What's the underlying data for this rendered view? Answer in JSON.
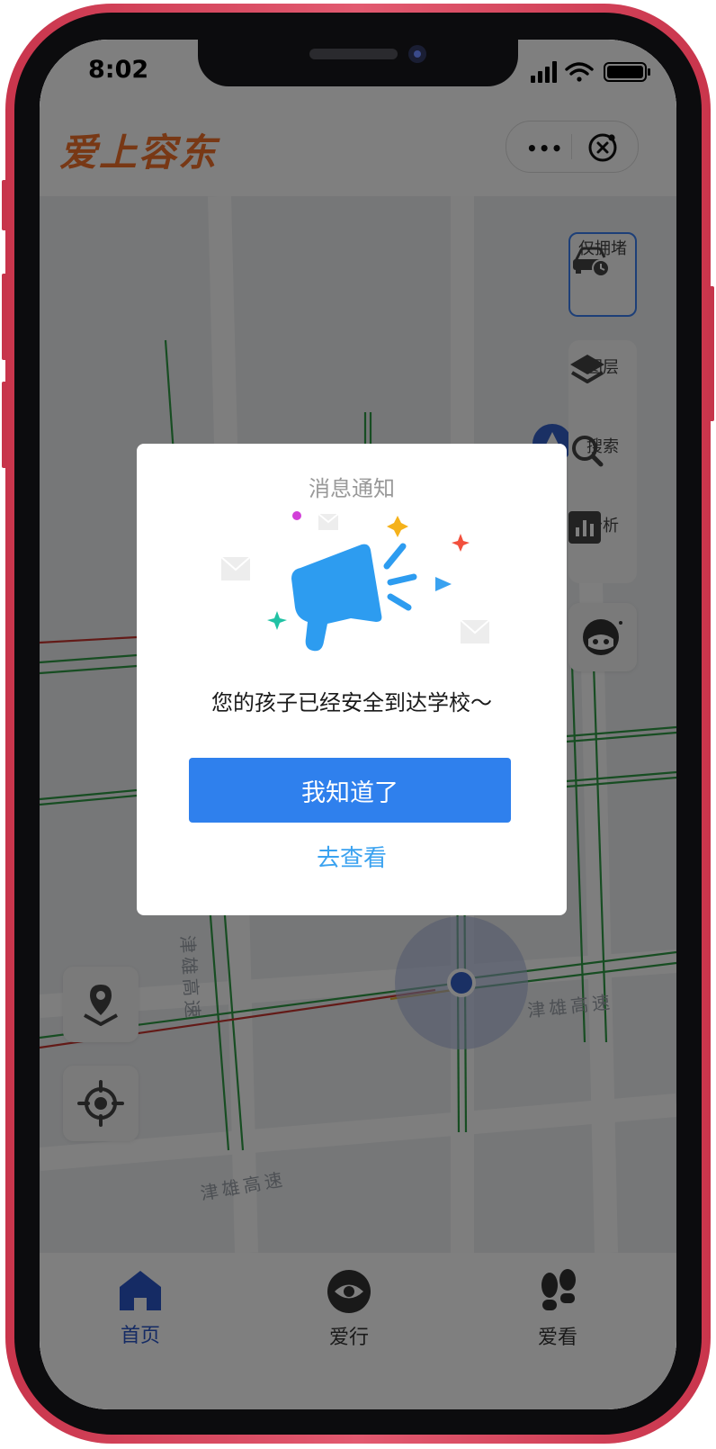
{
  "status_bar": {
    "time": "8:02"
  },
  "header": {
    "app_title": "爱上容东"
  },
  "map": {
    "congestion_filter_label": "仅拥堵",
    "tools": [
      {
        "label": "图层",
        "icon": "layers-icon"
      },
      {
        "label": "搜索",
        "icon": "search-icon"
      },
      {
        "label": "分析",
        "icon": "chart-icon"
      }
    ],
    "road_labels": [
      "津雄高速",
      "津雄高速",
      "津雄高速"
    ]
  },
  "modal": {
    "title": "消息通知",
    "message": "您的孩子已经安全到达学校～",
    "confirm_label": "我知道了",
    "view_label": "去查看"
  },
  "tabbar": {
    "items": [
      {
        "label": "首页",
        "icon": "home-icon",
        "active": true
      },
      {
        "label": "爱行",
        "icon": "eye-icon",
        "active": false
      },
      {
        "label": "爱看",
        "icon": "footprints-icon",
        "active": false
      }
    ]
  },
  "colors": {
    "frame": "#d2374f",
    "brand": "#f0702a",
    "primary": "#2f80ed",
    "link": "#3aa2f0",
    "tab_active": "#2a56c8"
  }
}
